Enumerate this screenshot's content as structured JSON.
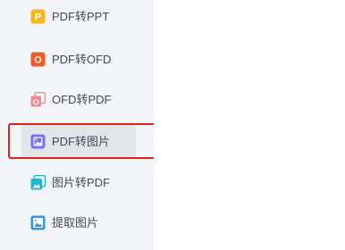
{
  "sidebar": {
    "items": [
      {
        "label": "PDF转PPT",
        "icon": "pdf-to-ppt-icon",
        "color": "#f7b719",
        "letter": "P",
        "active": false
      },
      {
        "label": "PDF转OFD",
        "icon": "pdf-to-ofd-icon",
        "color": "#f15a22",
        "letter": "O",
        "active": false
      },
      {
        "label": "OFD转PDF",
        "icon": "ofd-to-pdf-icon",
        "color": "#f08a8f",
        "letter": "O",
        "active": false
      },
      {
        "label": "PDF转图片",
        "icon": "pdf-to-image-icon",
        "color": "#7c6cf0",
        "active": true
      },
      {
        "label": "图片转PDF",
        "icon": "image-to-pdf-icon",
        "color": "#21b4cf",
        "active": false
      },
      {
        "label": "提取图片",
        "icon": "extract-image-icon",
        "color": "#2f96e8",
        "active": false
      }
    ]
  },
  "colors": {
    "sidebar_bg": "#f4f5f8",
    "active_bg": "#e3e4e8",
    "highlight_border": "#e0211a"
  }
}
